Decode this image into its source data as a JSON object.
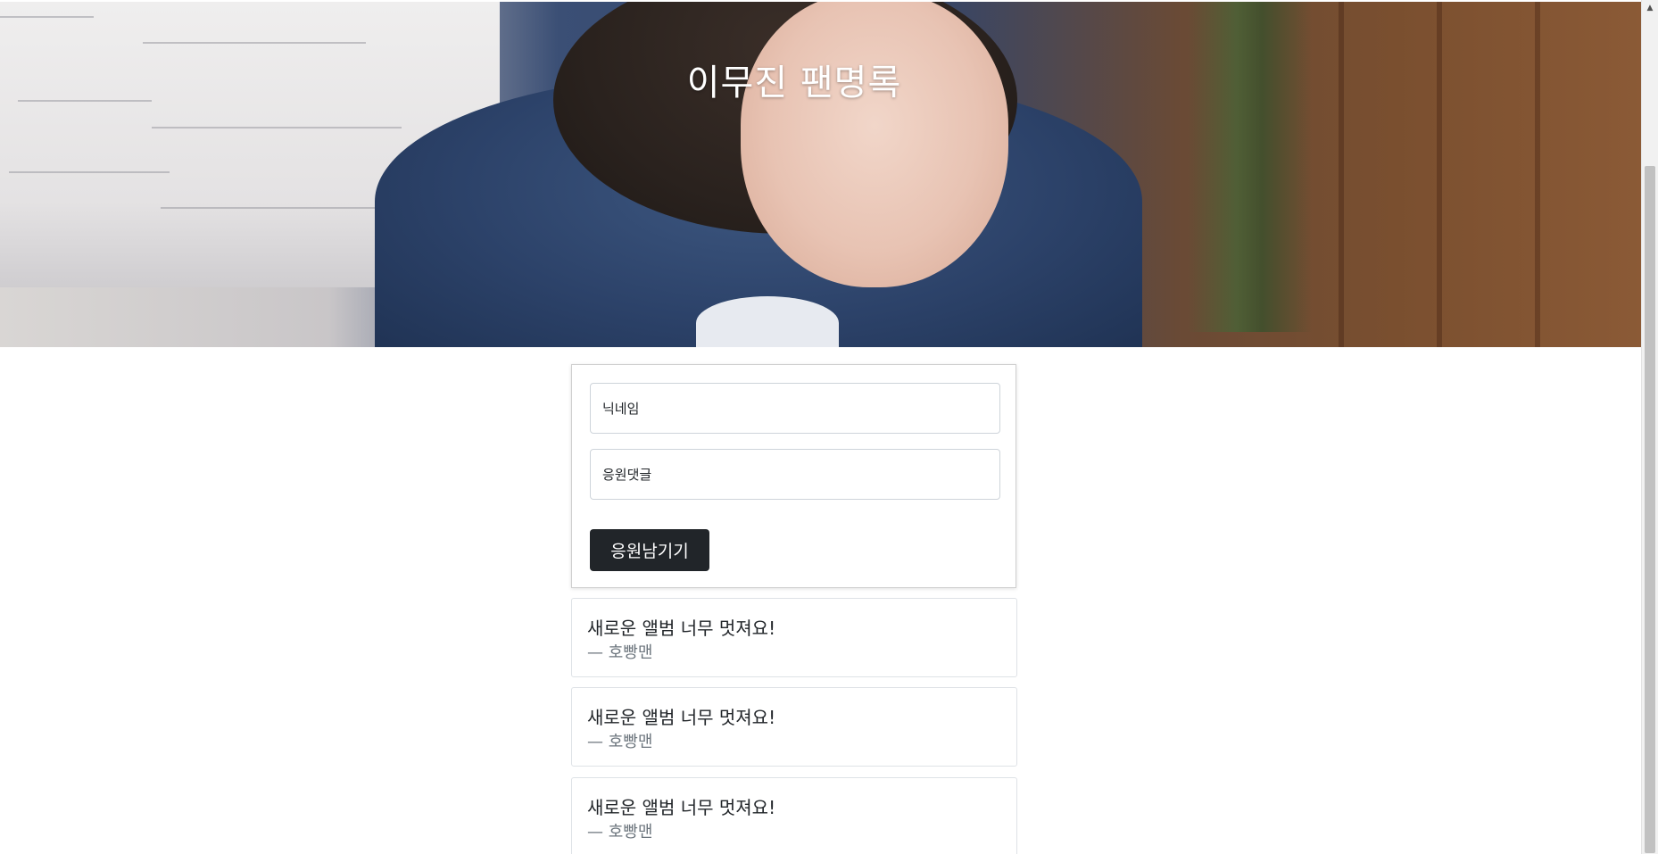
{
  "banner": {
    "title": "이무진 팬명록"
  },
  "form": {
    "nickname_placeholder": "닉네임",
    "comment_placeholder": "응원댓글",
    "submit_label": "응원남기기"
  },
  "comments": [
    {
      "text": "새로운 앨범 너무 멋져요!",
      "author": "— 호빵맨"
    },
    {
      "text": "새로운 앨범 너무 멋져요!",
      "author": "— 호빵맨"
    },
    {
      "text": "새로운 앨범 너무 멋져요!",
      "author": "— 호빵맨"
    }
  ],
  "colors": {
    "button_bg": "#212529",
    "author_text": "#6c757d",
    "title_text": "#ffffff"
  },
  "icons": {
    "scroll_up": "scroll-up-arrow-icon"
  }
}
